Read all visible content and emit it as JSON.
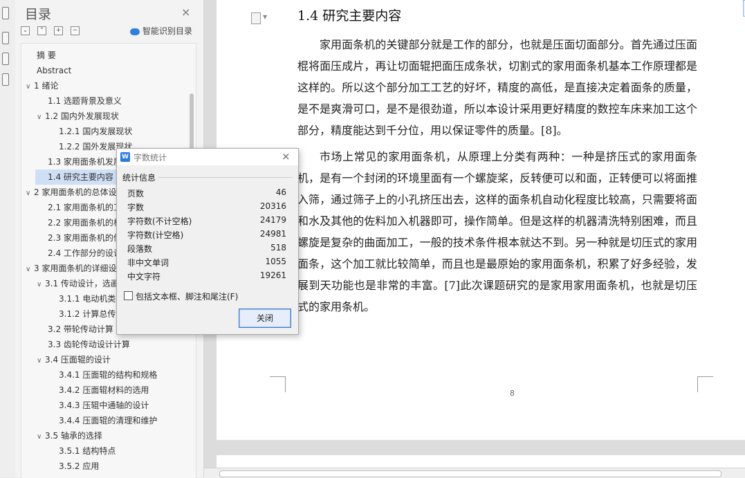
{
  "toc": {
    "title": "目录",
    "close_glyph": "×",
    "tools": [
      "⌄",
      "⌃",
      "+",
      "−"
    ],
    "smart_label": "智能识别目录",
    "items": [
      {
        "label": "摘    要"
      },
      {
        "label": "Abstract"
      },
      {
        "chevron": "∨",
        "label": "1 绪论"
      },
      {
        "label": "1.1 选题背景及意义"
      },
      {
        "chevron": "∨",
        "label": "1.2 国内外发展现状"
      },
      {
        "label": "1.2.1 国内发展现状"
      },
      {
        "label": "1.2.2 国外发展现状"
      },
      {
        "label": "1.3 家用面条机发展"
      },
      {
        "label": "1.4 研究主要内容"
      },
      {
        "chevron": "∨",
        "label": "2 家用面条机的总体设"
      },
      {
        "label": "2.1 家用面条机的工"
      },
      {
        "label": "2.2 家用面条机的机"
      },
      {
        "label": "2.3 家用面条机的传"
      },
      {
        "label": "2.4 工作部分的设计"
      },
      {
        "chevron": "∨",
        "label": "3 家用面条机的详细设"
      },
      {
        "chevron": "∨",
        "label": "3.1 传动设计，选画"
      },
      {
        "label": "3.1.1  电动机类"
      },
      {
        "label": "3.1.2  计算总传"
      },
      {
        "label": "3.2  带轮传动计算"
      },
      {
        "label": "3.3  齿轮传动设计计算"
      },
      {
        "chevron": "∨",
        "label": "3.4  压面辊的设计"
      },
      {
        "label": "3.4.1  压面辊的结构和规格"
      },
      {
        "label": "3.4.2  压面辊材料的选用"
      },
      {
        "label": "3.4.3  压辊中通轴的设计"
      },
      {
        "label": "3.4.4  压面辊的清理和维护"
      },
      {
        "chevron": "∨",
        "label": "3.5  轴承的选择"
      },
      {
        "label": "3.5.1  结构特点"
      },
      {
        "label": "3.5.2  应用"
      }
    ]
  },
  "document": {
    "heading": "1.4 研究主要内容",
    "paragraphs": [
      "家用面条机的关键部分就是工作的部分，也就是压面切面部分。首先通过压面棍将面压成片，再让切面辊把面压成条状，切割式的家用面条机基本工作原理都是这样的。所以这个部分加工工艺的好坏，精度的高低，是直接决定着面条的质量，是不是爽滑可口，是不是很劲道，所以本设计采用更好精度的数控车床来加工这个部分，精度能达到千分位，用以保证零件的质量。[8]。",
      "市场上常见的家用面条机，从原理上分类有两种：一种是挤压式的家用面条机，是有一个封闭的环境里面有一个螺旋桨，反转便可以和面，正转便可以将面推入筛，通过筛子上的小孔挤压出去，这样的面条机自动化程度比较高，只需要将面和水及其他的佐料加入机器即可，操作简单。但是这样的机器清洗特别困难，而且螺旋是复杂的曲面加工，一般的技术条件根本就达不到。另一种就是切压式的家用面条，这个加工就比较简单，而且也是最原始的家用面条机，积累了好多经验，发展到天功能也是非常的丰富。[7]此次课题研究的是家用家用面条机，也就是切压式的家用条机。"
    ],
    "page_number": "8"
  },
  "dialog": {
    "title": "字数统计",
    "close_glyph": "×",
    "group_label": "统计信息",
    "stats": [
      {
        "label": "页数",
        "value": "46"
      },
      {
        "label": "字数",
        "value": "20316"
      },
      {
        "label": "字符数(不计空格)",
        "value": "24179"
      },
      {
        "label": "字符数(计空格)",
        "value": "24981"
      },
      {
        "label": "段落数",
        "value": "518"
      },
      {
        "label": "非中文单词",
        "value": "1055"
      },
      {
        "label": "中文字符",
        "value": "19261"
      }
    ],
    "checkbox_label": "包括文本框、脚注和尾注(F)",
    "checkbox_checked": false,
    "close_button": "关闭"
  },
  "colors": {
    "accent": "#2e7bd8",
    "selection": "#cfdff5"
  }
}
